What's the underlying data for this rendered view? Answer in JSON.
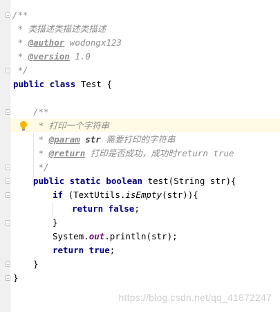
{
  "code": {
    "l1": "/**",
    "l2_prefix": " * ",
    "l2_text": "类描述类描述类描述",
    "l3_prefix": " * ",
    "l3_tag": "@author",
    "l3_text": " wodongx123",
    "l4_prefix": " * ",
    "l4_tag": "@version",
    "l4_text": " 1.0",
    "l5": " */",
    "l6_kw1": "public class",
    "l6_rest": " Test {",
    "l8": "/**",
    "l9_prefix": " * ",
    "l9_text": "打印一个字符串",
    "l10_prefix": " * ",
    "l10_tag": "@param",
    "l10_param": " str",
    "l10_text": " 需要打印的字符串",
    "l11_prefix": " * ",
    "l11_tag": "@return",
    "l11_text": " 打印是否成功，成功时return true",
    "l12": " */",
    "l13_kw": "public static boolean",
    "l13_rest": " test(String str){",
    "l14_kw": "if",
    "l14_a": " (TextUtils.",
    "l14_method": "isEmpty",
    "l14_b": "(str)){",
    "l15_kw": "return false",
    "l15_rest": ";",
    "l16": "}",
    "l17_a": "System.",
    "l17_field": "out",
    "l17_b": ".println(str);",
    "l18_kw": "return true",
    "l18_rest": ";",
    "l19": "}",
    "l20": "}"
  },
  "watermark": "https://blog.csdn.net/qq_41872247",
  "icons": {
    "intention": "lightbulb-icon",
    "fold": "fold-marker-icon"
  },
  "colors": {
    "keyword": "#000080",
    "comment": "#8c8c8c",
    "static_field": "#660e7a",
    "current_line": "#fffae3",
    "gutter": "#f0f0f0"
  }
}
